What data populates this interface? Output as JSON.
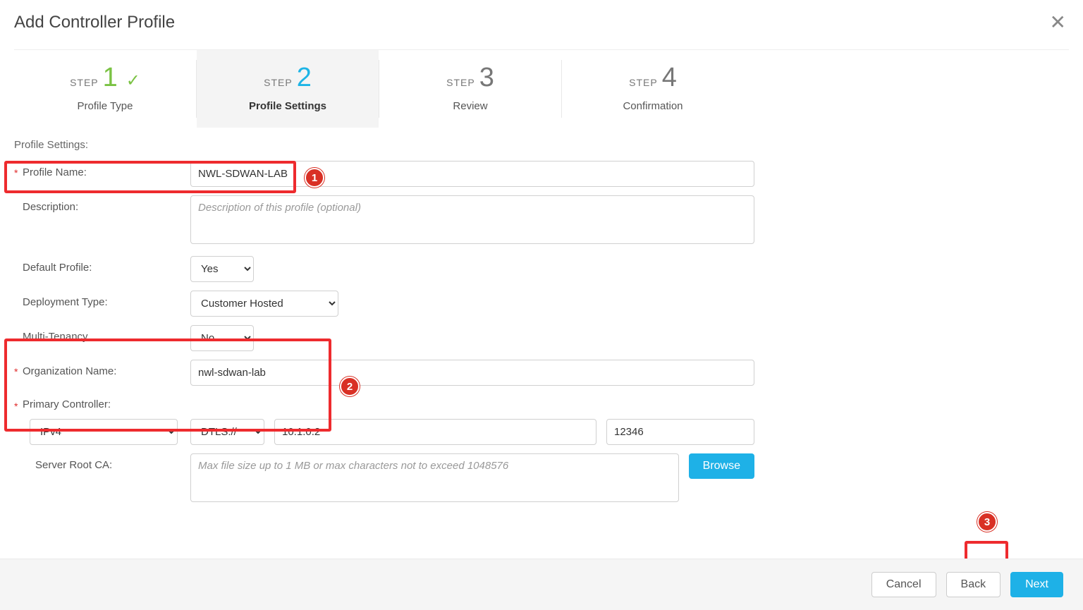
{
  "title": "Add Controller Profile",
  "steps": [
    {
      "word": "STEP",
      "num": "1",
      "label": "Profile Type",
      "state": "done"
    },
    {
      "word": "STEP",
      "num": "2",
      "label": "Profile Settings",
      "state": "active"
    },
    {
      "word": "STEP",
      "num": "3",
      "label": "Review",
      "state": ""
    },
    {
      "word": "STEP",
      "num": "4",
      "label": "Confirmation",
      "state": ""
    }
  ],
  "section_heading": "Profile Settings:",
  "labels": {
    "profile_name": "Profile Name:",
    "description": "Description:",
    "default_profile": "Default Profile:",
    "deployment_type": "Deployment Type:",
    "multi_tenancy": "Multi-Tenancy",
    "org_name": "Organization Name:",
    "primary_controller": "Primary Controller:",
    "server_root_ca": "Server Root CA:"
  },
  "values": {
    "profile_name": "NWL-SDWAN-LAB",
    "description": "",
    "default_profile": "Yes",
    "deployment_type": "Customer Hosted",
    "multi_tenancy": "No",
    "org_name": "nwl-sdwan-lab",
    "pc_protocol": "IPv4",
    "pc_scheme": "DTLS://",
    "pc_ip": "10.1.0.2",
    "pc_port": "12346",
    "server_root_ca": ""
  },
  "placeholders": {
    "description": "Description of this profile (optional)",
    "server_root_ca": "Max file size up to 1 MB or max characters not to exceed 1048576"
  },
  "buttons": {
    "browse": "Browse",
    "cancel": "Cancel",
    "back": "Back",
    "next": "Next"
  },
  "callouts": {
    "c1": "1",
    "c2": "2",
    "c3": "3"
  }
}
